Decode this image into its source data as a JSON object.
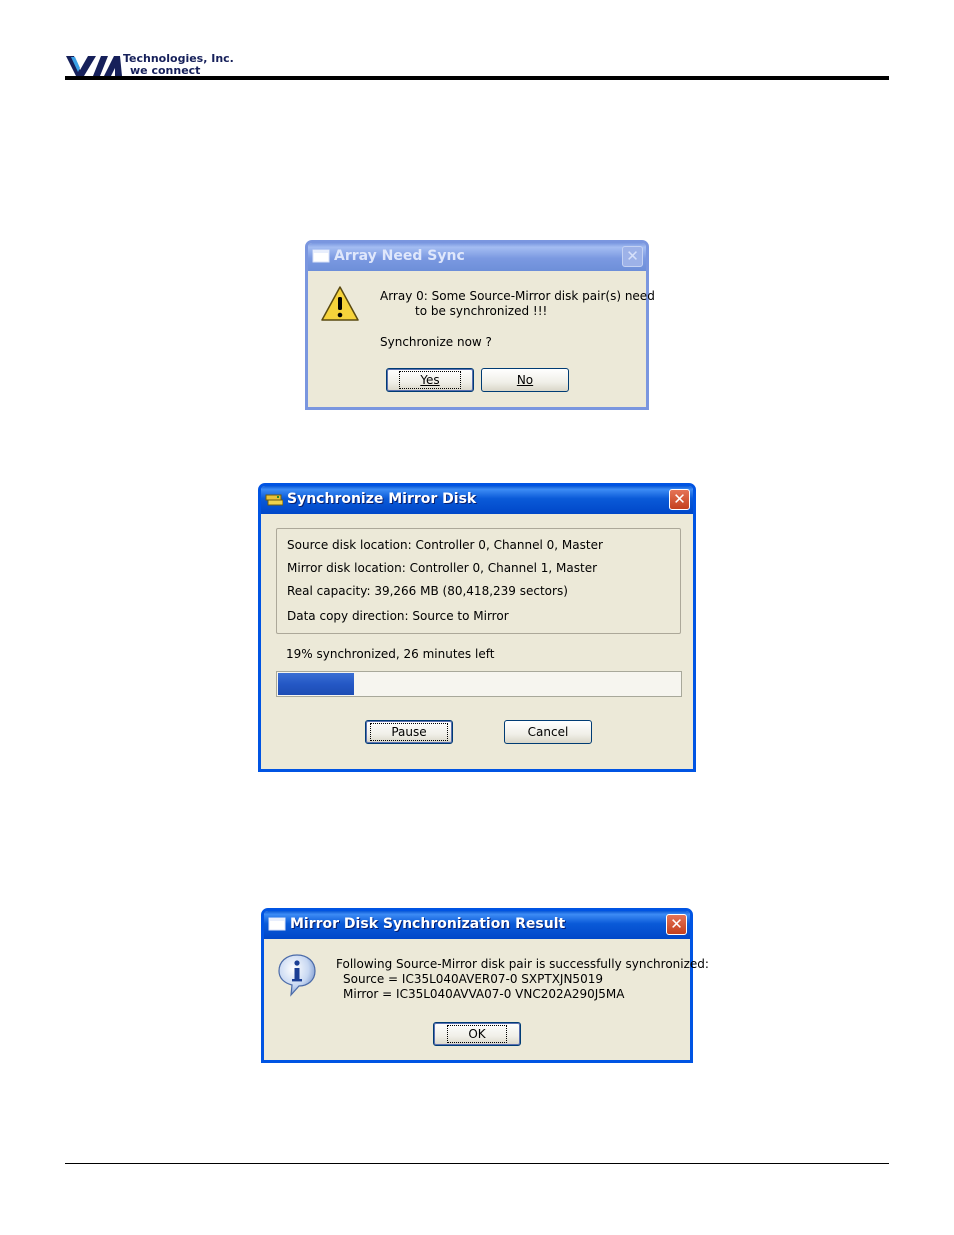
{
  "header": {
    "logo_mark": "VIA",
    "company": "Technologies, Inc.",
    "tagline": "we connect"
  },
  "dialog_sync_prompt": {
    "title": "Array Need Sync",
    "icon": "warning-icon",
    "message_line1": "Array 0: Some Source-Mirror disk pair(s) need",
    "message_line2": "to be synchronized !!!",
    "question": "Synchronize now ?",
    "yes_label": "Yes",
    "no_label": "No",
    "close_symbol": "✕"
  },
  "dialog_sync_progress": {
    "title": "Synchronize Mirror Disk",
    "details": [
      "Source disk location: Controller 0, Channel 0, Master",
      "Mirror disk location: Controller 0, Channel 1, Master",
      "Real capacity: 39,266 MB (80,418,239 sectors)",
      "Data copy direction: Source to Mirror"
    ],
    "status": "19% synchronized, 26 minutes left",
    "progress_fraction": 0.19,
    "pause_label": "Pause",
    "cancel_label": "Cancel",
    "close_symbol": "✕"
  },
  "dialog_sync_result": {
    "title": "Mirror Disk Synchronization Result",
    "icon": "info-icon",
    "message_line1": "Following Source-Mirror disk pair is successfully synchronized:",
    "message_line2": "Source = IC35L040AVER07-0 SXPTXJN5019",
    "message_line3": "Mirror = IC35L040AVVA07-0 VNC202A290J5MA",
    "ok_label": "OK",
    "close_symbol": "✕"
  },
  "colors": {
    "title_active": "#0054e3",
    "title_inactive": "#7a96df",
    "dialog_face": "#ece9d8",
    "progress_fill": "#2458c5"
  }
}
